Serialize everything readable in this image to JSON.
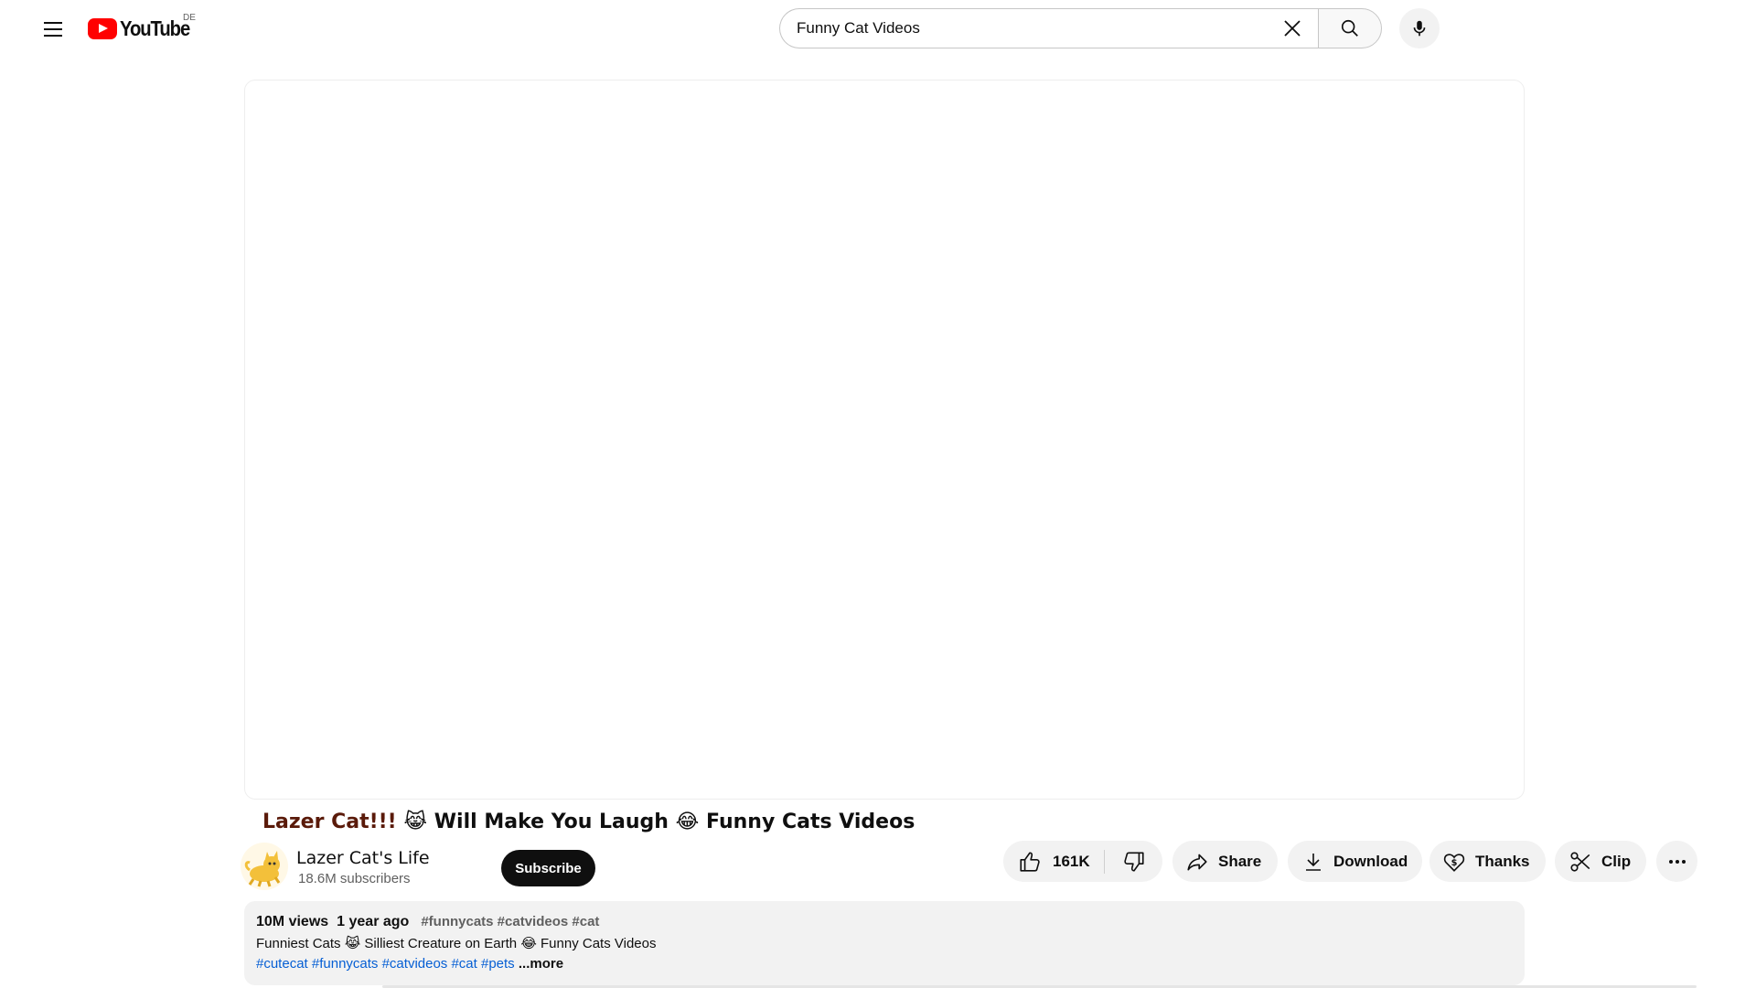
{
  "header": {
    "logo_text": "YouTube",
    "country_code": "DE",
    "search": {
      "value": "Funny Cat Videos",
      "placeholder": "Search"
    },
    "brand_color": "#ff0000"
  },
  "video": {
    "title_part1": "Lazer Cat!!!",
    "title_emoji1": "😹",
    "title_part2": "Will Make You Laugh",
    "title_emoji2": "😂",
    "title_part3": "Funny Cats Videos"
  },
  "owner": {
    "channel_name": "Lazer Cat's Life",
    "subscribers": "18.6M subscribers",
    "subscribe_label": "Subscribe"
  },
  "actions": {
    "like_count": "161K",
    "share_label": "Share",
    "download_label": "Download",
    "thanks_label": "Thanks",
    "clip_label": "Clip"
  },
  "description": {
    "views": "10M views",
    "date": "1 year ago",
    "header_tags": "#funnycats #catvideos #cat",
    "line1": "Funniest Cats 😹 Silliest Creature on Earth 😂 Funny Cats Videos",
    "tags": "#cutecat #funnycats #catvideos #cat #pets",
    "more_label": "...more"
  }
}
